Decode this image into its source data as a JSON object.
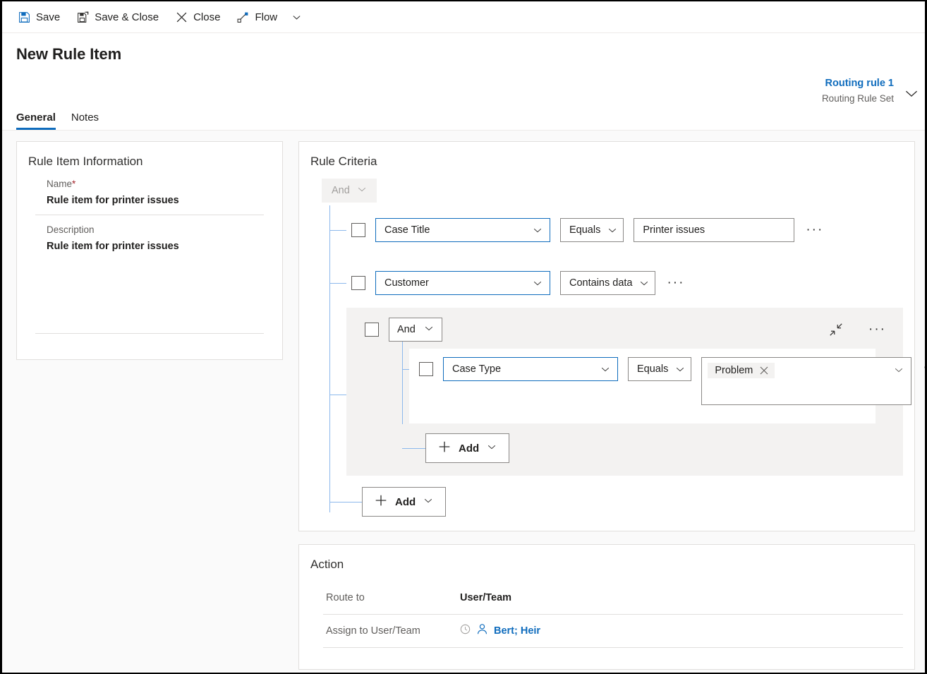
{
  "colors": {
    "accent": "#0f6cbd",
    "connector": "#8cb8ec",
    "required": "#a4262c",
    "neutral_bg": "#f3f2f1",
    "border": "#8a8886"
  },
  "commandbar": {
    "buttons": [
      {
        "label": "Save",
        "icon": "save-icon"
      },
      {
        "label": "Save & Close",
        "icon": "save-and-close-icon"
      },
      {
        "label": "Close",
        "icon": "close-x-icon"
      },
      {
        "label": "Flow",
        "icon": "flow-icon"
      }
    ],
    "overflow_chevron": "chevron-down-icon"
  },
  "header": {
    "title": "New Rule Item",
    "related_title": "Routing rule 1",
    "related_subtitle": "Routing Rule Set",
    "expand_chevron": "chevron-down-icon",
    "tabs": [
      {
        "label": "General",
        "active": true
      },
      {
        "label": "Notes",
        "active": false
      }
    ]
  },
  "rule_item_information": {
    "section_title": "Rule Item Information",
    "name_label": "Name",
    "name_required_marker": "*",
    "name_value": "Rule item for printer issues",
    "description_label": "Description",
    "description_value": "Rule item for printer issues"
  },
  "rule_criteria": {
    "section_title": "Rule Criteria",
    "root_operator": "And",
    "rows": [
      {
        "attribute": "Case Title",
        "operator": "Equals",
        "value": "Printer issues",
        "more_label": "···"
      },
      {
        "attribute": "Customer",
        "operator": "Contains data",
        "value": null,
        "more_label": "···"
      }
    ],
    "group": {
      "operator": "And",
      "collapse_icon": "collapse-icon",
      "more_label": "···",
      "row": {
        "attribute": "Case Type",
        "operator": "Equals",
        "value_tag": "Problem",
        "remove_tag_icon": "close-x-icon",
        "more_label": "···"
      },
      "add_label": "Add"
    },
    "add_label": "Add"
  },
  "action": {
    "section_title": "Action",
    "route_to_label": "Route to",
    "route_to_value": "User/Team",
    "assign_label": "Assign to User/Team",
    "assign_value": "Bert; Heir",
    "assign_recent_icon": "recent-clock-icon",
    "assign_person_icon": "person-icon"
  }
}
